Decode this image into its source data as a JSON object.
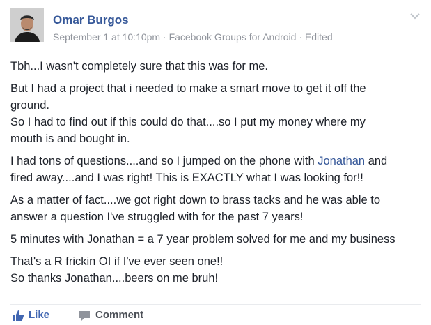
{
  "post": {
    "author": "Omar Burgos",
    "timestamp": "September 1 at 10:10pm",
    "separator": " · ",
    "source": "Facebook Groups for Android",
    "edited": "Edited",
    "options_icon": "chevron-down-icon",
    "paragraphs": [
      [
        "Tbh...I wasn't completely sure that this was for me."
      ],
      [
        "But I had a project that i needed to make a smart move to get it off the",
        "ground.",
        "So I had to find out if this could do that....so I put my money where my",
        "mouth is and bought in."
      ],
      [
        "I had tons of questions....and so I jumped on the phone with ",
        "Jonathan",
        " and",
        "fired away....and I was right! This is EXACTLY what I was looking for!!"
      ],
      [
        "As a matter of fact....we got right down to brass tacks and he was able to",
        "answer a question I've struggled with for the past 7 years!"
      ],
      [
        "5 minutes with Jonathan = a 7 year problem solved for me and my business"
      ],
      [
        "That's a R frickin OI if I've ever seen one!!",
        "So thanks Jonathan....beers on me bruh!"
      ]
    ]
  },
  "actions": {
    "like_label": "Like",
    "like_icon": "thumbs-up-icon",
    "comment_label": "Comment",
    "comment_icon": "speech-bubble-icon"
  },
  "colors": {
    "link": "#365899",
    "meta": "#90949c",
    "text": "#1d2129",
    "like": "#4267b2",
    "action": "#4b4f56"
  }
}
